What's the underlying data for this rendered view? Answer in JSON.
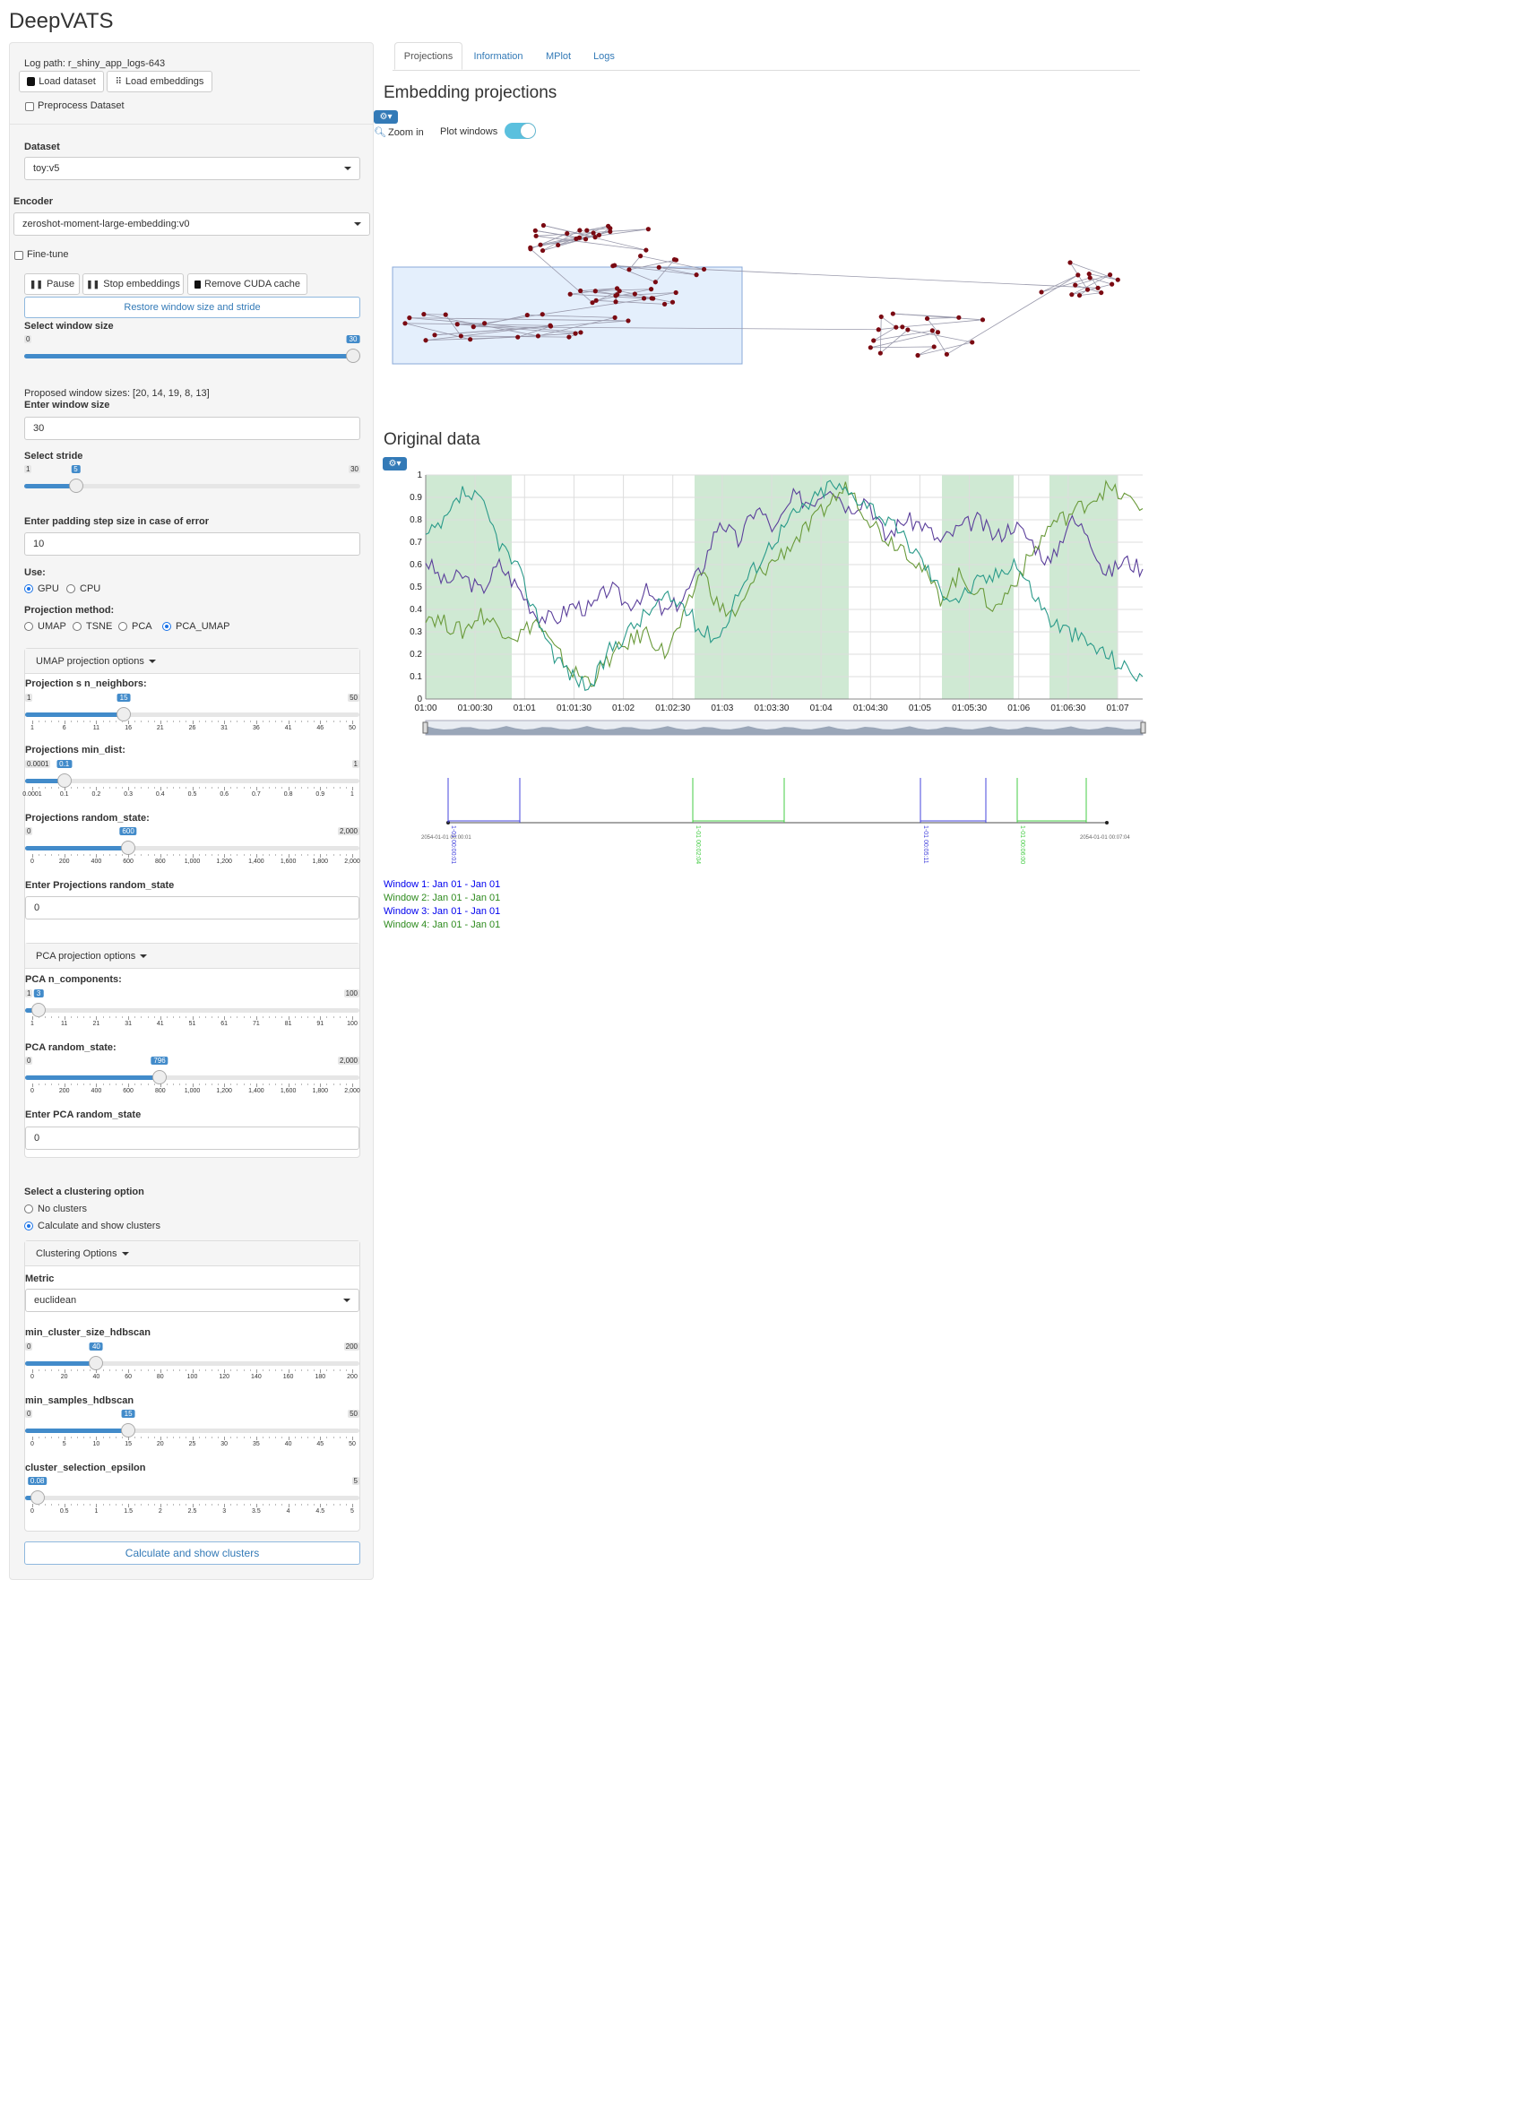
{
  "app": {
    "title": "DeepVATS"
  },
  "sidebar": {
    "log_path": "Log path: r_shiny_app_logs-643",
    "load_dataset": "Load dataset",
    "load_embeddings": "Load embeddings",
    "preprocess": "Preprocess Dataset",
    "dataset_label": "Dataset",
    "dataset_value": "toy:v5",
    "encoder_label": "Encoder",
    "encoder_value": "zeroshot-moment-large-embedding:v0",
    "finetune": "Fine-tune",
    "pause": "Pause",
    "stop_embeddings": "Stop embeddings",
    "remove_cuda": "Remove CUDA cache",
    "restore": "Restore window size and stride",
    "window_size_label": "Select window size",
    "window_size": {
      "min": "0",
      "max": "30",
      "value": "30",
      "fraction": 1.0
    },
    "proposed": "Proposed window sizes: [20, 14, 19, 8, 13]",
    "enter_window_label": "Enter window size",
    "enter_window_value": "30",
    "stride_label": "Select stride",
    "stride": {
      "min": "1",
      "max": "30",
      "value": "5",
      "fraction": 0.138
    },
    "padding_label": "Enter padding step size in case of error",
    "padding_value": "10",
    "use_label": "Use:",
    "use_options": [
      "GPU",
      "CPU"
    ],
    "projection_label": "Projection method:",
    "projection_options": [
      "UMAP",
      "TSNE",
      "PCA",
      "PCA_UMAP"
    ],
    "umap_panel": {
      "title": "UMAP projection options",
      "nn_label": "Projection s n_neighbors:",
      "nn": {
        "min": "1",
        "max": "50",
        "value": "15",
        "fraction": 0.286,
        "ticks": [
          "1",
          "6",
          "11",
          "16",
          "21",
          "26",
          "31",
          "36",
          "41",
          "46",
          "50"
        ]
      },
      "md_label": "Projections min_dist:",
      "md": {
        "min": "0.0001",
        "max": "1",
        "value": "0.1",
        "fraction": 0.1,
        "ticks": [
          "0.0001",
          "0.1",
          "0.2",
          "0.3",
          "0.4",
          "0.5",
          "0.6",
          "0.7",
          "0.8",
          "0.9",
          "1"
        ]
      },
      "rs_label": "Projections random_state:",
      "rs": {
        "min": "0",
        "max": "2,000",
        "value": "600",
        "fraction": 0.3,
        "ticks": [
          "0",
          "200",
          "400",
          "600",
          "800",
          "1,000",
          "1,200",
          "1,400",
          "1,600",
          "1,800",
          "2,000"
        ]
      },
      "enter_rs_label": "Enter Projections random_state",
      "enter_rs_value": "0"
    },
    "pca_panel": {
      "title": "PCA projection options",
      "nc_label": "PCA n_components:",
      "nc": {
        "min": "1",
        "max": "100",
        "value": "3",
        "fraction": 0.02,
        "ticks": [
          "1",
          "11",
          "21",
          "31",
          "41",
          "51",
          "61",
          "71",
          "81",
          "91",
          "100"
        ]
      },
      "rs_label": "PCA random_state:",
      "rs": {
        "min": "0",
        "max": "2,000",
        "value": "796",
        "fraction": 0.398,
        "ticks": [
          "0",
          "200",
          "400",
          "600",
          "800",
          "1,000",
          "1,200",
          "1,400",
          "1,600",
          "1,800",
          "2,000"
        ]
      },
      "enter_rs_label": "Enter PCA random_state",
      "enter_rs_value": "0"
    },
    "cluster_label": "Select a clustering option",
    "cluster_options": [
      "No clusters",
      "Calculate and show clusters"
    ],
    "cluster_panel": {
      "title": "Clustering Options",
      "metric_label": "Metric",
      "metric_value": "euclidean",
      "mcs_label": "min_cluster_size_hdbscan",
      "mcs": {
        "min": "0",
        "max": "200",
        "value": "40",
        "fraction": 0.2,
        "ticks": [
          "0",
          "20",
          "40",
          "60",
          "80",
          "100",
          "120",
          "140",
          "160",
          "180",
          "200"
        ]
      },
      "ms_label": "min_samples_hdbscan",
      "ms": {
        "min": "0",
        "max": "50",
        "value": "15",
        "fraction": 0.3,
        "ticks": [
          "0",
          "5",
          "10",
          "15",
          "20",
          "25",
          "30",
          "35",
          "40",
          "45",
          "50"
        ]
      },
      "eps_label": "cluster_selection_epsilon",
      "eps": {
        "min": "",
        "max": "5",
        "value": "0.08",
        "fraction": 0.016,
        "ticks": [
          "0",
          "0.5",
          "1",
          "1.5",
          "2",
          "2.5",
          "3",
          "3.5",
          "4",
          "4.5",
          "5"
        ]
      }
    },
    "calc_btn": "Calculate and show clusters"
  },
  "tabs": [
    "Projections",
    "Information",
    "MPlot",
    "Logs"
  ],
  "main": {
    "emb_title": "Embedding projections",
    "zoom_in": "Zoom in",
    "plot_windows": "Plot windows",
    "orig_title": "Original data",
    "windows": [
      {
        "text": "Window 1: Jan 01 - Jan 01",
        "color": "#0000ee"
      },
      {
        "text": "Window 2: Jan 01 - Jan 01",
        "color": "#2e8b1e"
      },
      {
        "text": "Window 3: Jan 01 - Jan 01",
        "color": "#0000ee"
      },
      {
        "text": "Window 4: Jan 01 - Jan 01",
        "color": "#2e8b1e"
      }
    ],
    "timeline_start": "2054-01-01 00:00:01",
    "timeline_end": "2054-01-01 00:07:04",
    "timeline_marks": [
      "1-01 00:00:01",
      "1-01 00:02:04",
      "1-01 00:05:11",
      "1-01 00:06:00"
    ]
  },
  "chart_data": {
    "type": "line",
    "x_ticks": [
      "01:00",
      "01:00:30",
      "01:01",
      "01:01:30",
      "01:02",
      "01:02:30",
      "01:03",
      "01:03:30",
      "01:04",
      "01:04:30",
      "01:05",
      "01:05:30",
      "01:06",
      "01:06:30",
      "01:07"
    ],
    "ylim": [
      0,
      1
    ],
    "y_ticks": [
      "0",
      "0.1",
      "0.2",
      "0.3",
      "0.4",
      "0.5",
      "0.6",
      "0.7",
      "0.8",
      "0.9",
      "1"
    ],
    "highlight_windows": [
      [
        0,
        0.12
      ],
      [
        0.375,
        0.59
      ],
      [
        0.72,
        0.82
      ],
      [
        0.87,
        0.965
      ]
    ],
    "series": [
      {
        "color": "#5b3f9b",
        "values": [
          0.62,
          0.52,
          0.55,
          0.48,
          0.6,
          0.5,
          0.38,
          0.35,
          0.42,
          0.4,
          0.5,
          0.42,
          0.48,
          0.38,
          0.45,
          0.58,
          0.8,
          0.7,
          0.86,
          0.75,
          0.9,
          0.88,
          0.96,
          0.85,
          0.9,
          0.72,
          0.8,
          0.78,
          0.7,
          0.76,
          0.8,
          0.72,
          0.78,
          0.7,
          0.6,
          0.8,
          0.75,
          0.55,
          0.62,
          0.58
        ]
      },
      {
        "color": "#6a9a3a",
        "values": [
          0.38,
          0.34,
          0.3,
          0.38,
          0.32,
          0.28,
          0.35,
          0.22,
          0.12,
          0.08,
          0.18,
          0.25,
          0.3,
          0.2,
          0.35,
          0.58,
          0.4,
          0.38,
          0.55,
          0.62,
          0.7,
          0.78,
          0.88,
          0.95,
          0.82,
          0.72,
          0.68,
          0.58,
          0.45,
          0.55,
          0.48,
          0.4,
          0.52,
          0.65,
          0.78,
          0.82,
          0.88,
          0.94,
          0.9,
          0.85
        ]
      },
      {
        "color": "#2a9a8a",
        "values": [
          0.72,
          0.78,
          0.92,
          0.88,
          0.7,
          0.58,
          0.38,
          0.2,
          0.1,
          0.05,
          0.22,
          0.3,
          0.38,
          0.45,
          0.42,
          0.3,
          0.28,
          0.48,
          0.6,
          0.72,
          0.82,
          0.88,
          0.96,
          0.92,
          0.88,
          0.8,
          0.72,
          0.62,
          0.48,
          0.45,
          0.52,
          0.55,
          0.62,
          0.48,
          0.35,
          0.3,
          0.25,
          0.2,
          0.14,
          0.1
        ]
      }
    ]
  }
}
